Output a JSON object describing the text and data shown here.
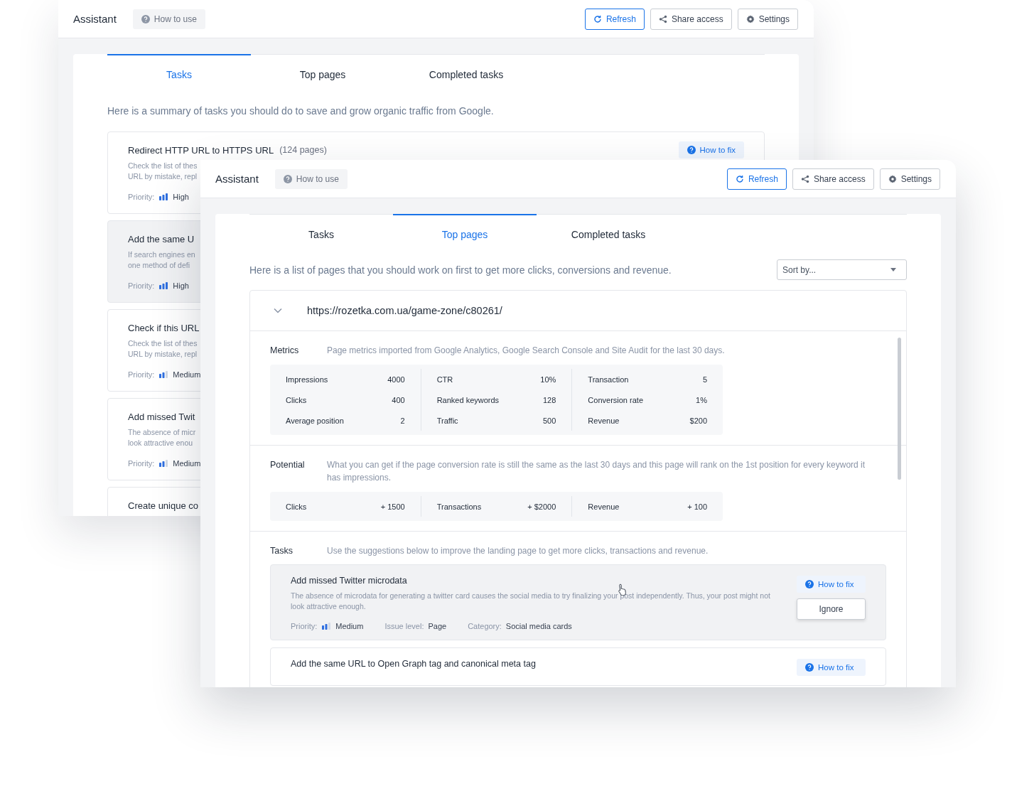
{
  "back_window": {
    "header": {
      "title": "Assistant",
      "help": "How to use",
      "actions": [
        {
          "label": "Refresh",
          "kind": "refresh"
        },
        {
          "label": "Share access",
          "kind": "share"
        },
        {
          "label": "Settings",
          "kind": "settings"
        }
      ]
    },
    "tabs": [
      {
        "label": "Tasks",
        "selected": true
      },
      {
        "label": "Top pages",
        "selected": false
      },
      {
        "label": "Completed tasks",
        "selected": false
      }
    ],
    "intro": "Here is a summary of tasks you should do to save and grow organic traffic from Google.",
    "tasks": [
      {
        "title": "Redirect HTTP URL to HTTPS URL",
        "count": "(124 pages)",
        "description": [
          "Check the list of thes",
          "URL by mistake, repl"
        ],
        "priority_label": "Priority:",
        "priority": "High",
        "kind": "high",
        "hovered": false,
        "fix_button": "How to fix"
      },
      {
        "title": "Add the same U",
        "description": [
          "If search engines en",
          "one method of defi"
        ],
        "priority_label": "Priority:",
        "priority": "High",
        "kind": "high",
        "hovered": true
      },
      {
        "title": "Check if this URL",
        "description": [
          "Check the list of thes",
          "URL by mistake, repl"
        ],
        "priority_label": "Priority:",
        "priority": "Medium",
        "kind": "medium",
        "hovered": false
      },
      {
        "title": "Add missed Twit",
        "description": [
          "The absence of micr",
          "look attractive enou"
        ],
        "priority_label": "Priority:",
        "priority": "Medium",
        "kind": "medium",
        "hovered": false
      },
      {
        "title": "Create unique co",
        "hovered": false
      }
    ]
  },
  "front_window": {
    "header": {
      "title": "Assistant",
      "help": "How to use",
      "actions": [
        {
          "label": "Refresh",
          "kind": "refresh"
        },
        {
          "label": "Share access",
          "kind": "share"
        },
        {
          "label": "Settings",
          "kind": "settings"
        }
      ]
    },
    "tabs": [
      {
        "label": "Tasks",
        "selected": false
      },
      {
        "label": "Top pages",
        "selected": true
      },
      {
        "label": "Completed tasks",
        "selected": false
      }
    ],
    "intro": "Here is a list of pages that you should work on first to get more clicks, conversions and revenue.",
    "sort_select": {
      "placeholder": "Sort by..."
    },
    "page": {
      "url": "https://rozetka.com.ua/game-zone/c80261/",
      "expanded": true,
      "metrics": {
        "label": "Metrics",
        "description": "Page metrics imported from Google Analytics, Google Search Console and Site Audit for the last 30 days.",
        "columns": [
          [
            {
              "name": "Impressions",
              "value": "4000"
            },
            {
              "name": "Clicks",
              "value": "400"
            },
            {
              "name": "Average position",
              "value": "2"
            }
          ],
          [
            {
              "name": "CTR",
              "value": "10%"
            },
            {
              "name": "Ranked keywords",
              "value": "128"
            },
            {
              "name": "Traffic",
              "value": "500"
            }
          ],
          [
            {
              "name": "Transaction",
              "value": "5"
            },
            {
              "name": "Conversion rate",
              "value": "1%"
            },
            {
              "name": "Revenue",
              "value": "$200"
            }
          ]
        ]
      },
      "potential": {
        "label": "Potential",
        "description": "What you can get if the page conversion rate is still the same as the last 30 days and this page will rank on the 1st position for every keyword it has impressions.",
        "columns": [
          [
            {
              "name": "Clicks",
              "value": "+ 1500"
            }
          ],
          [
            {
              "name": "Transactions",
              "value": "+ $2000"
            }
          ],
          [
            {
              "name": "Revenue",
              "value": "+ 100"
            }
          ]
        ]
      },
      "tasks": {
        "label": "Tasks",
        "description": "Use the suggestions below to improve the landing page to get more clicks, transactions and revenue.",
        "items": [
          {
            "title": "Add missed Twitter microdata",
            "description": "The absence of microdata for generating a twitter card causes the social media to try finalizing your post independently. Thus, your post might not look attractive enough.",
            "hovered": true,
            "fix_button": "How to fix",
            "ignore_button": "Ignore",
            "meta": [
              {
                "label": "Priority:",
                "value": "Medium",
                "kind": "medium"
              },
              {
                "label": "Issue level:",
                "value": "Page",
                "kind": "plain"
              },
              {
                "label": "Category:",
                "value": "Social media cards",
                "kind": "plain"
              }
            ]
          },
          {
            "title": "Add the same URL to Open Graph tag and canonical meta tag",
            "hovered": false,
            "fix_button": "How to fix"
          }
        ]
      }
    }
  }
}
